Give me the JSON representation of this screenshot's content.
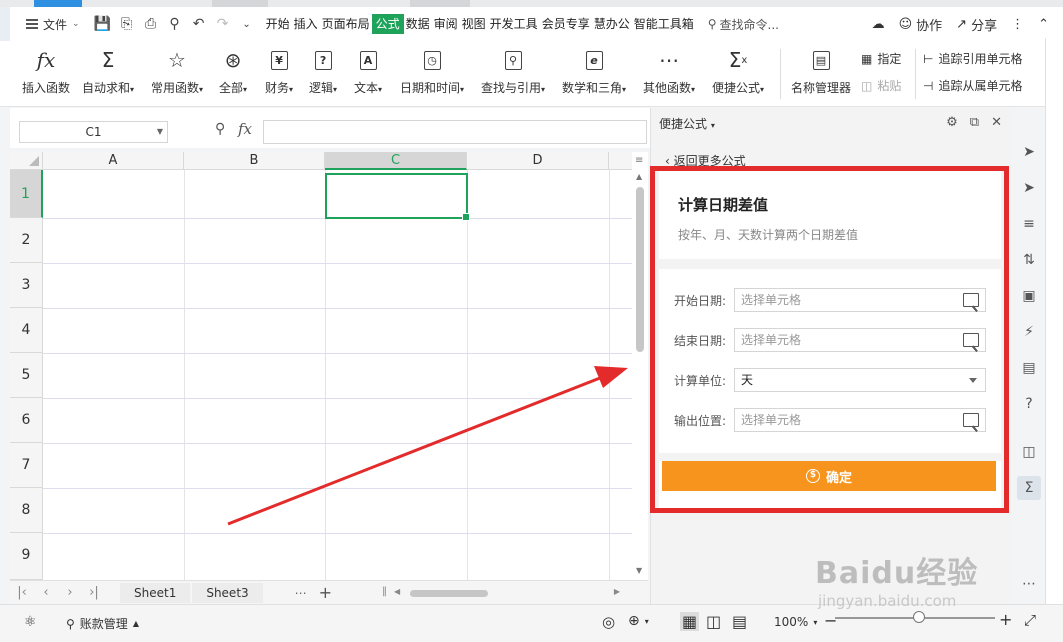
{
  "menubar": {
    "file": "文件",
    "tabs": [
      "开始",
      "插入",
      "页面布局",
      "公式",
      "数据",
      "审阅",
      "视图",
      "开发工具",
      "会员专享",
      "慧办公",
      "智能工具箱"
    ],
    "active_tab": "公式",
    "search": "查找命令...",
    "collab": "协作",
    "share": "分享"
  },
  "ribbon": {
    "insert_func": "插入函数",
    "autosum": "自动求和",
    "common": "常用函数",
    "all": "全部",
    "finance": "财务",
    "logic": "逻辑",
    "text": "文本",
    "datetime": "日期和时间",
    "lookup": "查找与引用",
    "math": "数学和三角",
    "other": "其他函数",
    "quick": "便捷公式",
    "name_mgr": "名称管理器",
    "specify": "指定",
    "paste": "粘贴",
    "trace_prec": "追踪引用单元格",
    "trace_dep": "追踪从属单元格"
  },
  "formula_bar": {
    "cell": "C1",
    "fx": "fx"
  },
  "grid": {
    "columns": [
      "A",
      "B",
      "C",
      "D"
    ],
    "rows": [
      "1",
      "2",
      "3",
      "4",
      "5",
      "6",
      "7",
      "8",
      "9"
    ],
    "selected_col": "C",
    "selected_row": "1"
  },
  "sheet_tabs": [
    "Sheet1",
    "Sheet3"
  ],
  "status": {
    "account": "账款管理",
    "zoom": "100%"
  },
  "panel": {
    "header": "便捷公式",
    "back": "返回更多公式",
    "title": "计算日期差值",
    "subtitle": "按年、月、天数计算两个日期差值",
    "fields": [
      {
        "label": "开始日期:",
        "placeholder": "选择单元格"
      },
      {
        "label": "结束日期:",
        "placeholder": "选择单元格"
      },
      {
        "label": "计算单位:",
        "value": "天"
      },
      {
        "label": "输出位置:",
        "placeholder": "选择单元格"
      }
    ],
    "confirm": "确定"
  },
  "watermark": {
    "main": "Baidu经验",
    "sub": "jingyan.baidu.com"
  },
  "colors": {
    "accent": "#1fa35a",
    "confirm": "#f7941d",
    "annotation": "#e32b2b"
  }
}
